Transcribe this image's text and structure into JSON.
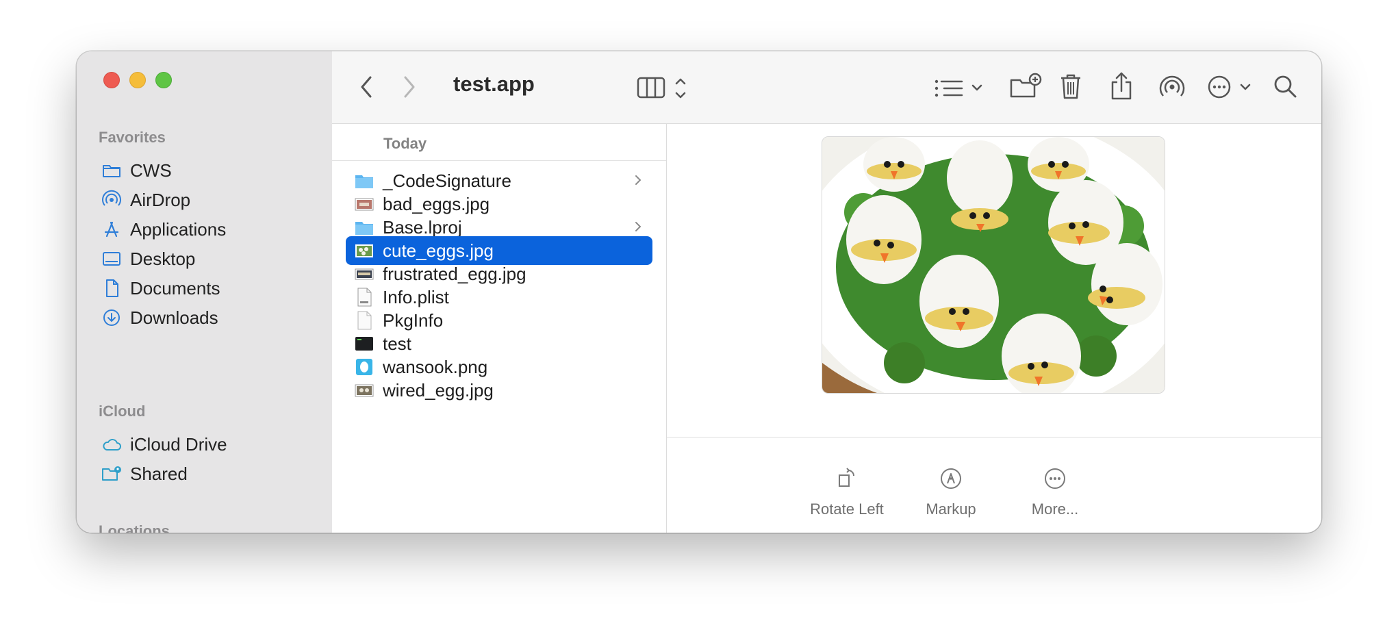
{
  "window": {
    "title": "test.app"
  },
  "sidebar": {
    "sections": [
      {
        "title": "Favorites",
        "items": [
          {
            "label": "CWS",
            "icon": "folder-icon"
          },
          {
            "label": "AirDrop",
            "icon": "airdrop-icon"
          },
          {
            "label": "Applications",
            "icon": "applications-icon"
          },
          {
            "label": "Desktop",
            "icon": "desktop-icon"
          },
          {
            "label": "Documents",
            "icon": "document-icon"
          },
          {
            "label": "Downloads",
            "icon": "download-icon"
          }
        ]
      },
      {
        "title": "iCloud",
        "items": [
          {
            "label": "iCloud Drive",
            "icon": "cloud-icon"
          },
          {
            "label": "Shared",
            "icon": "shared-folder-icon"
          }
        ]
      },
      {
        "title": "Locations",
        "items": []
      }
    ]
  },
  "file_list": {
    "group_header": "Today",
    "files": [
      {
        "name": "_CodeSignature",
        "type": "folder",
        "has_children": true
      },
      {
        "name": "bad_eggs.jpg",
        "type": "image"
      },
      {
        "name": "Base.lproj",
        "type": "folder",
        "has_children": true
      },
      {
        "name": "cute_eggs.jpg",
        "type": "image",
        "selected": true
      },
      {
        "name": "frustrated_egg.jpg",
        "type": "image"
      },
      {
        "name": "Info.plist",
        "type": "plist"
      },
      {
        "name": "PkgInfo",
        "type": "blank-document"
      },
      {
        "name": "test",
        "type": "executable"
      },
      {
        "name": "wansook.png",
        "type": "image"
      },
      {
        "name": "wired_egg.jpg",
        "type": "image"
      }
    ]
  },
  "preview": {
    "image_description_icon": "deviled-eggs-chicks-image",
    "actions": [
      {
        "label": "Rotate Left",
        "icon": "rotate-left-icon"
      },
      {
        "label": "Markup",
        "icon": "markup-icon"
      },
      {
        "label": "More...",
        "icon": "more-icon"
      }
    ]
  },
  "colors": {
    "selection": "#0b63dc",
    "accent_icon": "#2f7ed8",
    "sidebar_bg": "#e6e5e6"
  }
}
